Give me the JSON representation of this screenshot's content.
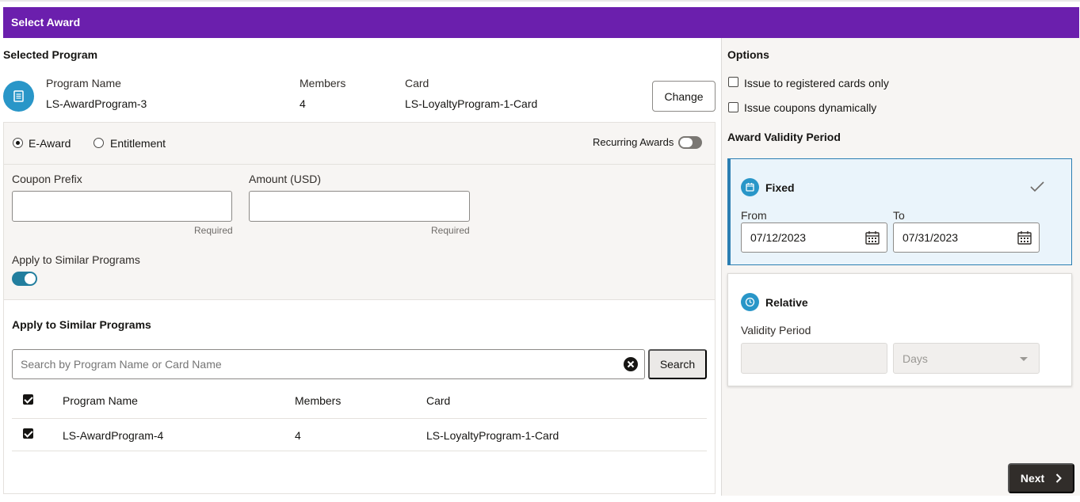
{
  "header": {
    "title": "Select Award"
  },
  "selected_program": {
    "heading": "Selected Program",
    "program_name_label": "Program Name",
    "program_name": "LS-AwardProgram-3",
    "members_label": "Members",
    "members": "4",
    "card_label": "Card",
    "card": "LS-LoyaltyProgram-1-Card",
    "change_label": "Change",
    "icon": "document-icon"
  },
  "award_type": {
    "options": [
      "E-Award",
      "Entitlement"
    ],
    "selected": "E-Award",
    "recurring_label": "Recurring Awards",
    "recurring_on": false
  },
  "coupon": {
    "prefix_label": "Coupon Prefix",
    "prefix_value": "",
    "amount_label": "Amount (USD)",
    "amount_value": "",
    "required_text": "Required"
  },
  "apply_similar": {
    "toggle_label": "Apply to Similar Programs",
    "toggle_on": true,
    "section_title": "Apply to Similar Programs",
    "search_placeholder": "Search by Program Name or Card Name",
    "search_button": "Search",
    "columns": [
      "Program Name",
      "Members",
      "Card"
    ],
    "header_checked": true,
    "rows": [
      {
        "checked": true,
        "program_name": "LS-AwardProgram-4",
        "members": "4",
        "card": "LS-LoyaltyProgram-1-Card"
      }
    ]
  },
  "options": {
    "heading": "Options",
    "items": [
      {
        "label": "Issue to registered cards only",
        "checked": false
      },
      {
        "label": "Issue coupons dynamically",
        "checked": false
      }
    ]
  },
  "validity": {
    "heading": "Award Validity Period",
    "fixed": {
      "title": "Fixed",
      "selected": true,
      "from_label": "From",
      "from_value": "07/12/2023",
      "to_label": "To",
      "to_value": "07/31/2023"
    },
    "relative": {
      "title": "Relative",
      "period_label": "Validity Period",
      "period_value": "",
      "unit_value": "Days"
    }
  },
  "footer": {
    "next_label": "Next"
  },
  "colors": {
    "header_bg": "#6b1fad",
    "accent": "#2996c8",
    "toggle_on": "#227e9e",
    "primary_button": "#312d2a"
  }
}
